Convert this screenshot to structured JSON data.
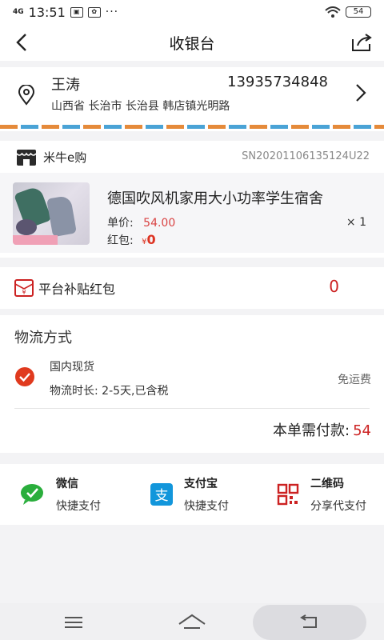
{
  "status_bar": {
    "signal": "4G",
    "time": "13:51",
    "battery": "54"
  },
  "nav": {
    "title": "收银台"
  },
  "address": {
    "name": "王涛",
    "phone": "13935734848",
    "detail": "山西省 长治市 长治县 韩店镇光明路"
  },
  "order": {
    "shop_name": "米牛e购",
    "serial": "SN20201106135124U22",
    "product_title": "德国吹风机家用大小功率学生宿舍",
    "price_label": "单价:",
    "price_value": "54.00",
    "quantity": "× 1",
    "red_label": "红包:",
    "red_currency": "¥",
    "red_value": "0"
  },
  "subsidy": {
    "label": "平台补贴红包",
    "value": "0"
  },
  "logistics": {
    "heading": "物流方式",
    "option": "国内现货",
    "duration": "物流时长: 2-5天,已含税",
    "shipping": "免运费",
    "total_label": "本单需付款:",
    "total_value": "54"
  },
  "payments": [
    {
      "title": "微信",
      "subtitle": "快捷支付",
      "icon": "wechat-icon"
    },
    {
      "title": "支付宝",
      "subtitle": "快捷支付",
      "icon": "alipay-icon"
    },
    {
      "title": "二维码",
      "subtitle": "分享代支付",
      "icon": "qrcode-icon"
    }
  ],
  "colors": {
    "accent_red": "#c22",
    "wechat": "#2aae3c",
    "alipay": "#1296db"
  }
}
